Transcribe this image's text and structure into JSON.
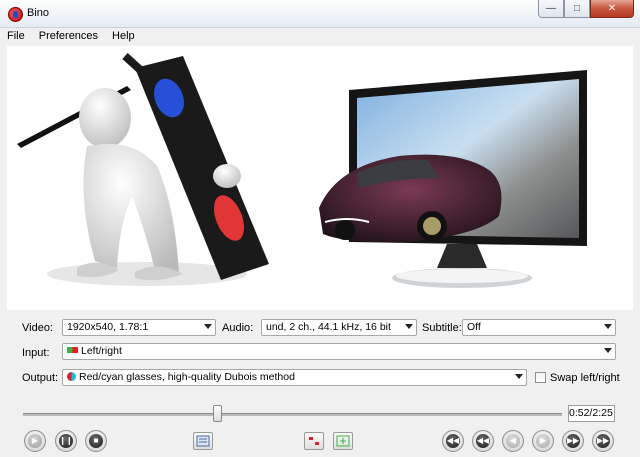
{
  "window": {
    "title": "Bino",
    "app_icon": "bino-3d-glasses-icon"
  },
  "menu": [
    {
      "label": "File"
    },
    {
      "label": "Preferences"
    },
    {
      "label": "Help"
    }
  ],
  "video_row": {
    "video_label": "Video:",
    "video_value": "1920x540, 1.78:1",
    "audio_label": "Audio:",
    "audio_value": "und, 2 ch., 44.1 kHz, 16 bit",
    "subtitle_label": "Subtitle:",
    "subtitle_value": "Off"
  },
  "input_row": {
    "label": "Input:",
    "value": "Left/right",
    "swatch_colors": [
      "#3cb043",
      "#e02020"
    ]
  },
  "output_row": {
    "label": "Output:",
    "value": "Red/cyan glasses, high-quality Dubois method",
    "swap_label": "Swap left/right",
    "swap_checked": false,
    "icon_colors": [
      "#e02020",
      "#20b8d8"
    ]
  },
  "playback": {
    "time": "0:52/2:25",
    "progress": 0.36
  },
  "controls": {
    "play_icon": "play-icon",
    "pause_icon": "pause-icon",
    "stop_icon": "stop-icon",
    "fullscreen_icon": "fullscreen-icon",
    "shrink_icon": "shrink-icon",
    "grow_icon": "grow-icon",
    "seek_buttons": [
      "seek-back-10m-icon",
      "seek-back-1m-icon",
      "seek-back-10s-icon",
      "seek-fwd-10s-icon",
      "seek-fwd-1m-icon",
      "seek-fwd-10m-icon"
    ]
  }
}
